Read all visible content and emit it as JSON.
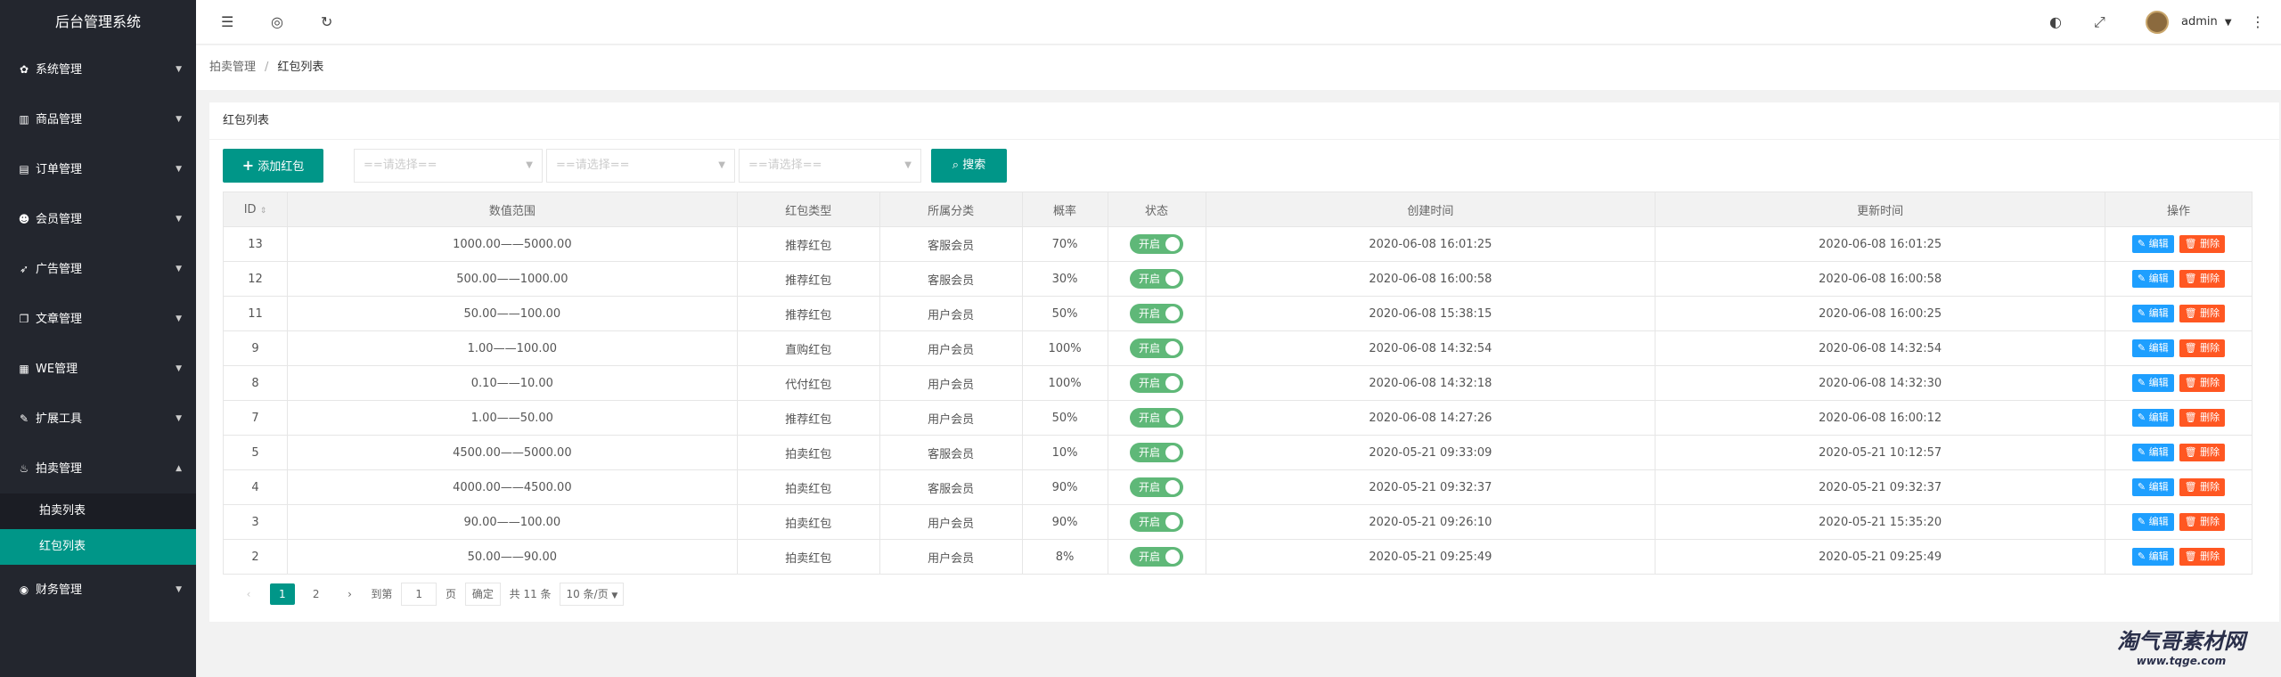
{
  "app": {
    "title": "后台管理系统"
  },
  "sidebar": {
    "items": [
      {
        "label": "系统管理",
        "icon": "gear-icon",
        "glyph": "✿"
      },
      {
        "label": "商品管理",
        "icon": "chart-icon",
        "glyph": "▥"
      },
      {
        "label": "订单管理",
        "icon": "calendar-icon",
        "glyph": "▤"
      },
      {
        "label": "会员管理",
        "icon": "users-icon",
        "glyph": "☻"
      },
      {
        "label": "广告管理",
        "icon": "rocket-icon",
        "glyph": "➶"
      },
      {
        "label": "文章管理",
        "icon": "file-icon",
        "glyph": "❐"
      },
      {
        "label": "WE管理",
        "icon": "store-icon",
        "glyph": "▦"
      },
      {
        "label": "扩展工具",
        "icon": "wrench-icon",
        "glyph": "✎"
      },
      {
        "label": "拍卖管理",
        "icon": "fire-icon",
        "glyph": "♨"
      }
    ],
    "subitems": [
      {
        "label": "拍卖列表"
      },
      {
        "label": "红包列表"
      }
    ],
    "last": {
      "label": "财务管理",
      "icon": "finance-icon",
      "glyph": "◉"
    }
  },
  "header": {
    "user": "admin"
  },
  "breadcrumb": {
    "parent": "拍卖管理",
    "current": "红包列表"
  },
  "card": {
    "title": "红包列表"
  },
  "toolbar": {
    "add_label": "添加红包",
    "select1": "==请选择==",
    "select2": "==请选择==",
    "select3": "==请选择==",
    "search_label": "搜索"
  },
  "table": {
    "headers": [
      "ID",
      "数值范围",
      "红包类型",
      "所属分类",
      "概率",
      "状态",
      "创建时间",
      "更新时间",
      "操作"
    ],
    "switch_label": "开启",
    "edit_label": "编辑",
    "delete_label": "删除",
    "rows": [
      {
        "id": "13",
        "range": "1000.00——5000.00",
        "type": "推荐红包",
        "category": "客服会员",
        "prob": "70%",
        "created": "2020-06-08 16:01:25",
        "updated": "2020-06-08 16:01:25"
      },
      {
        "id": "12",
        "range": "500.00——1000.00",
        "type": "推荐红包",
        "category": "客服会员",
        "prob": "30%",
        "created": "2020-06-08 16:00:58",
        "updated": "2020-06-08 16:00:58"
      },
      {
        "id": "11",
        "range": "50.00——100.00",
        "type": "推荐红包",
        "category": "用户会员",
        "prob": "50%",
        "created": "2020-06-08 15:38:15",
        "updated": "2020-06-08 16:00:25"
      },
      {
        "id": "9",
        "range": "1.00——100.00",
        "type": "直购红包",
        "category": "用户会员",
        "prob": "100%",
        "created": "2020-06-08 14:32:54",
        "updated": "2020-06-08 14:32:54"
      },
      {
        "id": "8",
        "range": "0.10——10.00",
        "type": "代付红包",
        "category": "用户会员",
        "prob": "100%",
        "created": "2020-06-08 14:32:18",
        "updated": "2020-06-08 14:32:30"
      },
      {
        "id": "7",
        "range": "1.00——50.00",
        "type": "推荐红包",
        "category": "用户会员",
        "prob": "50%",
        "created": "2020-06-08 14:27:26",
        "updated": "2020-06-08 16:00:12"
      },
      {
        "id": "5",
        "range": "4500.00——5000.00",
        "type": "拍卖红包",
        "category": "客服会员",
        "prob": "10%",
        "created": "2020-05-21 09:33:09",
        "updated": "2020-05-21 10:12:57"
      },
      {
        "id": "4",
        "range": "4000.00——4500.00",
        "type": "拍卖红包",
        "category": "客服会员",
        "prob": "90%",
        "created": "2020-05-21 09:32:37",
        "updated": "2020-05-21 09:32:37"
      },
      {
        "id": "3",
        "range": "90.00——100.00",
        "type": "拍卖红包",
        "category": "用户会员",
        "prob": "90%",
        "created": "2020-05-21 09:26:10",
        "updated": "2020-05-21 15:35:20"
      },
      {
        "id": "2",
        "range": "50.00——90.00",
        "type": "拍卖红包",
        "category": "用户会员",
        "prob": "8%",
        "created": "2020-05-21 09:25:49",
        "updated": "2020-05-21 09:25:49"
      }
    ]
  },
  "pager": {
    "page1": "1",
    "page2": "2",
    "goto_label": "到第",
    "goto_value": "1",
    "page_unit": "页",
    "confirm_label": "确定",
    "total": "共 11 条",
    "per_page": "10 条/页"
  },
  "watermark": {
    "text": "淘气哥素材网",
    "url": "www.tqge.com"
  }
}
